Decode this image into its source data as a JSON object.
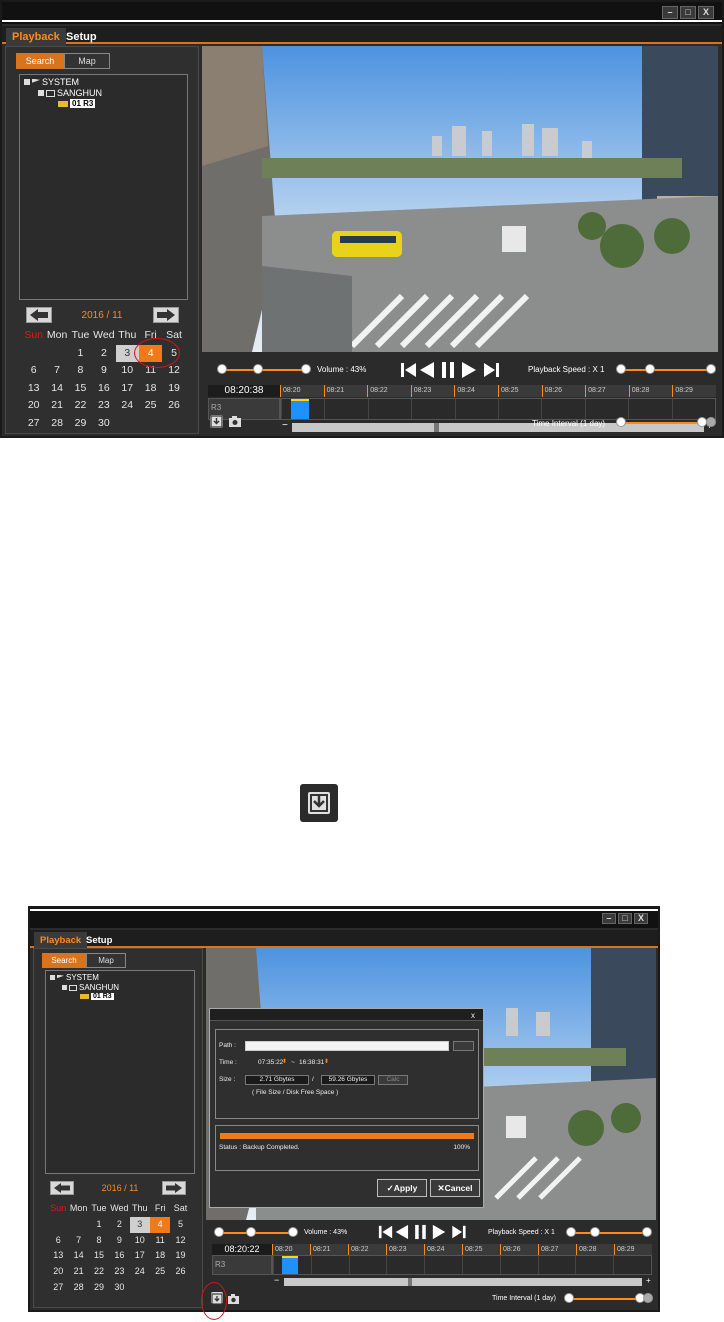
{
  "window_buttons": {
    "minimize": "–",
    "restore": "□",
    "close": "X"
  },
  "menu": {
    "playback": "Playback",
    "setup": "Setup"
  },
  "left_tabs": {
    "search": "Search",
    "map": "Map"
  },
  "tree": {
    "root": "SYSTEM",
    "child": "SANGHUN",
    "camera": "01 R3"
  },
  "calendar": {
    "month": "2016 / 11",
    "weekdays": [
      "Sun",
      "Mon",
      "Tue",
      "Wed",
      "Thu",
      "Fri",
      "Sat"
    ],
    "days": [
      "",
      "",
      "1",
      "2",
      "3",
      "4",
      "5",
      "6",
      "7",
      "8",
      "9",
      "10",
      "11",
      "12",
      "13",
      "14",
      "15",
      "16",
      "17",
      "18",
      "19",
      "20",
      "21",
      "22",
      "23",
      "24",
      "25",
      "26",
      "27",
      "28",
      "29",
      "30"
    ],
    "grey_day": "3",
    "selected_day": "4"
  },
  "controls": {
    "volume": "Volume : 43%",
    "volume_level": 0.43,
    "playback_speed": "Playback Speed : X 1",
    "time_interval": "Time Interval (1 day)"
  },
  "timeline1": {
    "current_time": "08:20:38",
    "channel": "R3",
    "ticks": [
      "08:20",
      "08:21",
      "08:22",
      "08:23",
      "08:24",
      "08:25",
      "08:26",
      "08:27",
      "08:28",
      "08:29"
    ]
  },
  "timeline2": {
    "current_time": "08:20:22",
    "channel": "R3",
    "ticks": [
      "08:20",
      "08:21",
      "08:22",
      "08:23",
      "08:24",
      "08:25",
      "08:26",
      "08:27",
      "08:28",
      "08:29"
    ]
  },
  "dialog": {
    "close": "x",
    "path_label": "Path :",
    "time_label": "Time :",
    "time_start": "07:35:22",
    "time_sep": "~",
    "time_end": "16:38:31",
    "size_label": "Size :",
    "file_size": "2.71 Gbytes",
    "size_sep": "/",
    "disk_free": "59.26 Gbytes",
    "calc_button": "Calc",
    "size_note": "( File Size  /  Disk Free Space )",
    "status": "Status :  Backup Completed.",
    "percent": "100%",
    "progress": 1.0,
    "apply": "Apply",
    "cancel": "Cancel"
  },
  "colors": {
    "accent": "#ef7a1a",
    "panel": "#2b2b2b",
    "marker": "#1e90ff",
    "highlight_circle": "#d41414"
  },
  "icons": [
    "download-icon",
    "camera-icon",
    "arrow-left-icon",
    "arrow-right-icon",
    "skip-start-icon",
    "rewind-icon",
    "pause-icon",
    "play-icon",
    "skip-end-icon"
  ]
}
